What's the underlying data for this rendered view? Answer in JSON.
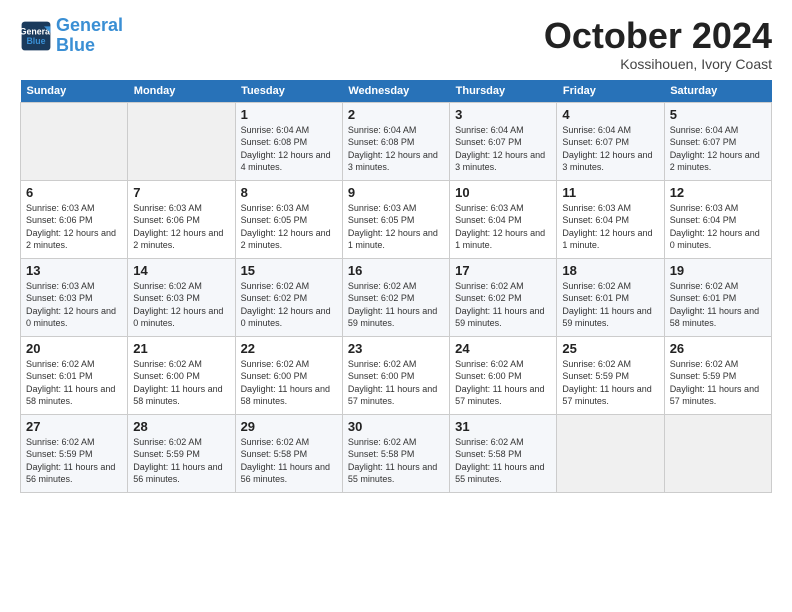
{
  "logo": {
    "line1": "General",
    "line2": "Blue"
  },
  "title": "October 2024",
  "subtitle": "Kossihouen, Ivory Coast",
  "days_header": [
    "Sunday",
    "Monday",
    "Tuesday",
    "Wednesday",
    "Thursday",
    "Friday",
    "Saturday"
  ],
  "weeks": [
    [
      {
        "day": "",
        "info": ""
      },
      {
        "day": "",
        "info": ""
      },
      {
        "day": "1",
        "info": "Sunrise: 6:04 AM\nSunset: 6:08 PM\nDaylight: 12 hours and 4 minutes."
      },
      {
        "day": "2",
        "info": "Sunrise: 6:04 AM\nSunset: 6:08 PM\nDaylight: 12 hours and 3 minutes."
      },
      {
        "day": "3",
        "info": "Sunrise: 6:04 AM\nSunset: 6:07 PM\nDaylight: 12 hours and 3 minutes."
      },
      {
        "day": "4",
        "info": "Sunrise: 6:04 AM\nSunset: 6:07 PM\nDaylight: 12 hours and 3 minutes."
      },
      {
        "day": "5",
        "info": "Sunrise: 6:04 AM\nSunset: 6:07 PM\nDaylight: 12 hours and 2 minutes."
      }
    ],
    [
      {
        "day": "6",
        "info": "Sunrise: 6:03 AM\nSunset: 6:06 PM\nDaylight: 12 hours and 2 minutes."
      },
      {
        "day": "7",
        "info": "Sunrise: 6:03 AM\nSunset: 6:06 PM\nDaylight: 12 hours and 2 minutes."
      },
      {
        "day": "8",
        "info": "Sunrise: 6:03 AM\nSunset: 6:05 PM\nDaylight: 12 hours and 2 minutes."
      },
      {
        "day": "9",
        "info": "Sunrise: 6:03 AM\nSunset: 6:05 PM\nDaylight: 12 hours and 1 minute."
      },
      {
        "day": "10",
        "info": "Sunrise: 6:03 AM\nSunset: 6:04 PM\nDaylight: 12 hours and 1 minute."
      },
      {
        "day": "11",
        "info": "Sunrise: 6:03 AM\nSunset: 6:04 PM\nDaylight: 12 hours and 1 minute."
      },
      {
        "day": "12",
        "info": "Sunrise: 6:03 AM\nSunset: 6:04 PM\nDaylight: 12 hours and 0 minutes."
      }
    ],
    [
      {
        "day": "13",
        "info": "Sunrise: 6:03 AM\nSunset: 6:03 PM\nDaylight: 12 hours and 0 minutes."
      },
      {
        "day": "14",
        "info": "Sunrise: 6:02 AM\nSunset: 6:03 PM\nDaylight: 12 hours and 0 minutes."
      },
      {
        "day": "15",
        "info": "Sunrise: 6:02 AM\nSunset: 6:02 PM\nDaylight: 12 hours and 0 minutes."
      },
      {
        "day": "16",
        "info": "Sunrise: 6:02 AM\nSunset: 6:02 PM\nDaylight: 11 hours and 59 minutes."
      },
      {
        "day": "17",
        "info": "Sunrise: 6:02 AM\nSunset: 6:02 PM\nDaylight: 11 hours and 59 minutes."
      },
      {
        "day": "18",
        "info": "Sunrise: 6:02 AM\nSunset: 6:01 PM\nDaylight: 11 hours and 59 minutes."
      },
      {
        "day": "19",
        "info": "Sunrise: 6:02 AM\nSunset: 6:01 PM\nDaylight: 11 hours and 58 minutes."
      }
    ],
    [
      {
        "day": "20",
        "info": "Sunrise: 6:02 AM\nSunset: 6:01 PM\nDaylight: 11 hours and 58 minutes."
      },
      {
        "day": "21",
        "info": "Sunrise: 6:02 AM\nSunset: 6:00 PM\nDaylight: 11 hours and 58 minutes."
      },
      {
        "day": "22",
        "info": "Sunrise: 6:02 AM\nSunset: 6:00 PM\nDaylight: 11 hours and 58 minutes."
      },
      {
        "day": "23",
        "info": "Sunrise: 6:02 AM\nSunset: 6:00 PM\nDaylight: 11 hours and 57 minutes."
      },
      {
        "day": "24",
        "info": "Sunrise: 6:02 AM\nSunset: 6:00 PM\nDaylight: 11 hours and 57 minutes."
      },
      {
        "day": "25",
        "info": "Sunrise: 6:02 AM\nSunset: 5:59 PM\nDaylight: 11 hours and 57 minutes."
      },
      {
        "day": "26",
        "info": "Sunrise: 6:02 AM\nSunset: 5:59 PM\nDaylight: 11 hours and 57 minutes."
      }
    ],
    [
      {
        "day": "27",
        "info": "Sunrise: 6:02 AM\nSunset: 5:59 PM\nDaylight: 11 hours and 56 minutes."
      },
      {
        "day": "28",
        "info": "Sunrise: 6:02 AM\nSunset: 5:59 PM\nDaylight: 11 hours and 56 minutes."
      },
      {
        "day": "29",
        "info": "Sunrise: 6:02 AM\nSunset: 5:58 PM\nDaylight: 11 hours and 56 minutes."
      },
      {
        "day": "30",
        "info": "Sunrise: 6:02 AM\nSunset: 5:58 PM\nDaylight: 11 hours and 55 minutes."
      },
      {
        "day": "31",
        "info": "Sunrise: 6:02 AM\nSunset: 5:58 PM\nDaylight: 11 hours and 55 minutes."
      },
      {
        "day": "",
        "info": ""
      },
      {
        "day": "",
        "info": ""
      }
    ]
  ]
}
